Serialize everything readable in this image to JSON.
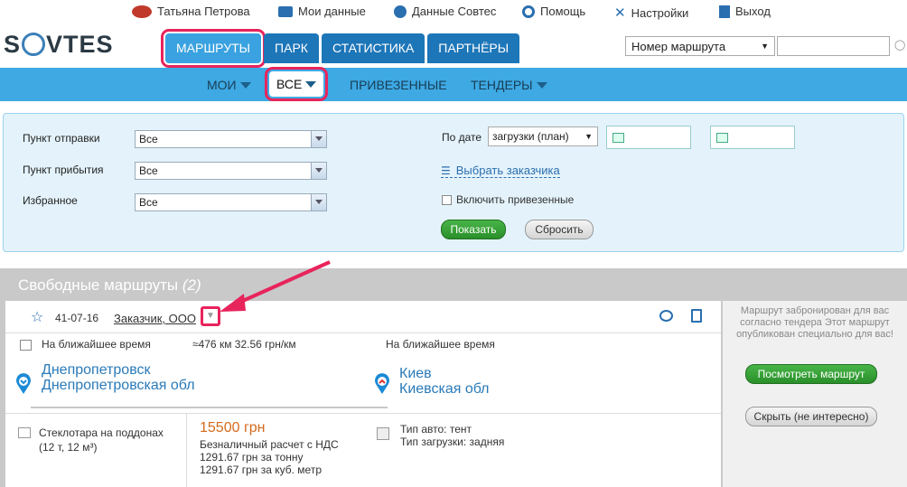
{
  "topbar": {
    "user": "Татьяна Петрова",
    "my_data": "Мои данные",
    "sovtes_data": "Данные Совтес",
    "help": "Помощь",
    "settings": "Настройки",
    "logout": "Выход"
  },
  "logo": {
    "left": "S",
    "right": "VTES"
  },
  "tabs": [
    "МАРШРУТЫ",
    "ПАРК",
    "СТАТИСТИКА",
    "ПАРТНЁРЫ"
  ],
  "route_select": "Номер маршрута",
  "subnav": {
    "mine": "МОИ",
    "all": "ВСЕ",
    "delivered": "ПРИВЕЗЕННЫЕ",
    "tenders": "ТЕНДЕРЫ"
  },
  "filter": {
    "departure_label": "Пункт отправки",
    "departure_value": "Все",
    "arrival_label": "Пункт прибытия",
    "arrival_value": "Все",
    "favorite_label": "Избранное",
    "favorite_value": "Все",
    "date_label": "По дате",
    "date_value": "загрузки (план)",
    "choose_customer": "Выбрать заказчика",
    "include_delivered": "Включить привезенные",
    "show": "Показать",
    "reset": "Сбросить"
  },
  "routes": {
    "title": "Свободные маршруты",
    "count": "(2)",
    "route_no": "41-07-16",
    "customer": "Заказчик, ООО",
    "time_from": "На ближайшее время",
    "distance": "≈476 км  32.56 грн/км",
    "time_to": "На ближайшее время",
    "from_city": "Днепропетровск",
    "from_region": "Днепропетровская обл",
    "to_city": "Киев",
    "to_region": "Киевская обл",
    "cargo": "Стеклотара на поддонах",
    "cargo_size": "(12 т, 12 м³)",
    "price": "15500 грн",
    "payment": "Безналичный расчет с НДС",
    "per_ton": "1291.67 грн за тонну",
    "per_m3": "1291.67 грн за куб. метр",
    "truck_type": "Тип авто: тент",
    "loading_type": "Тип загрузки: задняя",
    "side_note": "Маршрут забронирован для вас согласно тендера Этот маршрут опубликован специально для вас!",
    "view_button": "Посмотреть маршрут",
    "hide_button": "Скрыть (не интересно)"
  },
  "colors": {
    "brand_blue": "#1d76b8",
    "subnav_blue": "#3ea9e3",
    "highlight": "#e8245c",
    "green": "#2a8f2a",
    "price": "#d46a1a"
  }
}
